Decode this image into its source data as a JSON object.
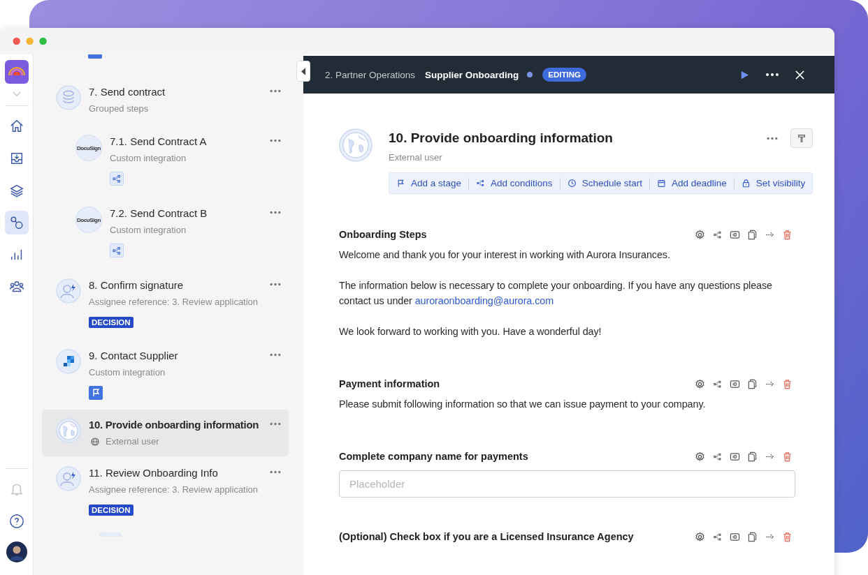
{
  "rail": {
    "top": [
      {
        "kind": "home",
        "selected": false
      },
      {
        "kind": "inbox",
        "selected": false
      },
      {
        "kind": "layers",
        "selected": false
      },
      {
        "kind": "flow",
        "selected": true
      },
      {
        "kind": "chart",
        "selected": false
      },
      {
        "kind": "users",
        "selected": false
      }
    ],
    "bottom": [
      {
        "kind": "bell",
        "selected": false
      },
      {
        "kind": "help",
        "selected": false
      },
      {
        "kind": "avatar",
        "selected": false
      }
    ]
  },
  "sidebar": {
    "steps": [
      {
        "title": "7. Send contract",
        "subtitle": "Grouped steps",
        "kind": "group",
        "selected": false,
        "children": [
          {
            "title": "7.1. Send Contract A",
            "subtitle": "Custom integration",
            "kind": "integration",
            "logo_text": "DocuSign",
            "selected": false
          },
          {
            "title": "7.2. Send Contract B",
            "subtitle": "Custom integration",
            "kind": "integration",
            "logo_text": "DocuSign",
            "selected": false
          }
        ]
      },
      {
        "title": "8. Confirm signature",
        "subtitle": "Assignee reference: 3. Review application",
        "kind": "assignee",
        "tag": "DECISION",
        "selected": false
      },
      {
        "title": "9. Contact Supplier",
        "subtitle": "Custom integration",
        "kind": "service",
        "selected": false
      },
      {
        "title": "10. Provide onboarding information",
        "subtitle": "External user",
        "kind": "external",
        "selected": true
      },
      {
        "title": "11. Review Onboarding Info",
        "subtitle": "Assignee reference: 3. Review application",
        "kind": "assignee",
        "tag": "DECISION",
        "selected": false
      }
    ]
  },
  "header": {
    "breadcrumb": "2. Partner Operations",
    "title": "Supplier Onboarding",
    "status": "EDITING"
  },
  "step": {
    "title": "10. Provide onboarding information",
    "subtitle": "External user",
    "actions": [
      {
        "label": "Add a stage"
      },
      {
        "label": "Add conditions"
      },
      {
        "label": "Schedule start"
      },
      {
        "label": "Add deadline"
      },
      {
        "label": "Set visibility"
      }
    ]
  },
  "sections": [
    {
      "kind": "text",
      "title": "Onboarding Steps",
      "paragraphs": [
        {
          "text": "Welcome and thank you for your interest in working with Aurora Insurances."
        },
        {
          "text": "The information below is necessary to complete your onboarding. If you have any questions please contact us under",
          "link": "auroraonboarding@aurora.com"
        },
        {
          "text": "We look forward to working with you. Have a wonderful day!"
        }
      ]
    },
    {
      "kind": "text",
      "title": "Payment information",
      "paragraphs": [
        {
          "text": "Please submit following information so that we can issue payment to your company."
        }
      ]
    },
    {
      "kind": "input",
      "title": "Complete company name for payments",
      "placeholder": "Placeholder"
    },
    {
      "kind": "checkbox",
      "title": "(Optional) Check box if you are a Licensed Insurance Agency"
    }
  ]
}
